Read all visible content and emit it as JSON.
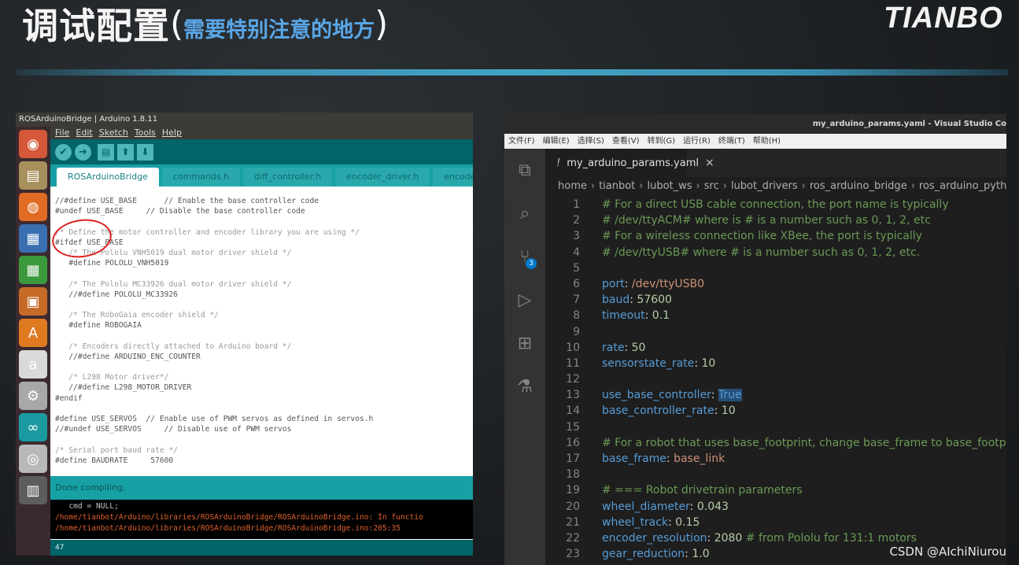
{
  "slide": {
    "title_main": "调试配置",
    "paren_open": "(",
    "title_sub": "需要特别注意的地方",
    "paren_close": ")",
    "logo": "TIANBO",
    "watermark": "CSDN @AIchiNiurou",
    "colors": {
      "title_sub": "#5aa7e8",
      "divider": "#48b8dd"
    }
  },
  "arduino": {
    "window_title": "ROSArduinoBridge | Arduino 1.8.11",
    "menu": [
      "File",
      "Edit",
      "Sketch",
      "Tools",
      "Help"
    ],
    "toolbar": {
      "verify_icon": "check-icon",
      "upload_icon": "arrow-right-icon",
      "new_icon": "new-file-icon",
      "open_icon": "open-arrow-up-icon",
      "save_icon": "save-arrow-down-icon"
    },
    "tabs": [
      "ROSArduinoBridge",
      "commands.h",
      "diff_controller.h",
      "encoder_driver.h",
      "encoder_"
    ],
    "active_tab": "ROSArduinoBridge",
    "code_lines": [
      {
        "text": "//#define USE_BASE      // Enable the base controller code",
        "style": "kw"
      },
      {
        "text": "#undef USE_BASE     // Disable the base controller code",
        "style": "kw"
      },
      {
        "text": "",
        "style": ""
      },
      {
        "text": "/* Define the motor controller and encoder library you are using */",
        "style": "cmt"
      },
      {
        "text": "#ifdef USE_BASE",
        "style": "kw"
      },
      {
        "text": "   /* The Pololu VNH5019 dual motor driver shield */",
        "style": "cmt"
      },
      {
        "text": "   #define POLOLU_VNH5019",
        "style": "kw"
      },
      {
        "text": "",
        "style": ""
      },
      {
        "text": "   /* The Pololu MC33926 dual motor driver shield */",
        "style": "cmt"
      },
      {
        "text": "   //#define POLOLU_MC33926",
        "style": "kw"
      },
      {
        "text": "",
        "style": ""
      },
      {
        "text": "   /* The RoboGaia encoder shield */",
        "style": "cmt"
      },
      {
        "text": "   #define ROBOGAIA",
        "style": "kw"
      },
      {
        "text": "",
        "style": ""
      },
      {
        "text": "   /* Encoders directly attached to Arduino board */",
        "style": "cmt"
      },
      {
        "text": "   //#define ARDUINO_ENC_COUNTER",
        "style": "kw"
      },
      {
        "text": "",
        "style": ""
      },
      {
        "text": "   /* L298 Motor driver*/",
        "style": "cmt"
      },
      {
        "text": "   //#define L298_MOTOR_DRIVER",
        "style": "kw"
      },
      {
        "text": "#endif",
        "style": "kw"
      },
      {
        "text": "",
        "style": ""
      },
      {
        "text": "#define USE_SERVOS  // Enable use of PWM servos as defined in servos.h",
        "style": "kw"
      },
      {
        "text": "//#undef USE_SERVOS     // Disable use of PWM servos",
        "style": "kw"
      },
      {
        "text": "",
        "style": ""
      },
      {
        "text": "/* Serial port baud rate */",
        "style": "cmt"
      },
      {
        "text": "#define BAUDRATE     57600",
        "style": "kw"
      }
    ],
    "status": "Done compiling.",
    "console_lines": [
      {
        "text": "   cmd = NULL;",
        "style": "dim"
      },
      {
        "text": "/home/tianbot/Arduino/libraries/ROSArduinoBridge/ROSArduinoBridge.ino: In functio",
        "style": ""
      },
      {
        "text": "/home/tianbot/Arduino/libraries/ROSArduinoBridge/ROSArduinoBridge.ino:205:35",
        "style": ""
      }
    ],
    "footer": "47",
    "launcher_icons": [
      {
        "name": "ubuntu-icon",
        "glyph": "◉",
        "bg": "#d4583a"
      },
      {
        "name": "files-icon",
        "glyph": "▤",
        "bg": "#a8905c"
      },
      {
        "name": "firefox-icon",
        "glyph": "◍",
        "bg": "#e06b22"
      },
      {
        "name": "writer-icon",
        "glyph": "▦",
        "bg": "#3a6fb0"
      },
      {
        "name": "calc-icon",
        "glyph": "▦",
        "bg": "#3c9a3c"
      },
      {
        "name": "impress-icon",
        "glyph": "▣",
        "bg": "#c66a28"
      },
      {
        "name": "software-center-icon",
        "glyph": "A",
        "bg": "#e07a20"
      },
      {
        "name": "amazon-icon",
        "glyph": "a",
        "bg": "#d9d9d9"
      },
      {
        "name": "settings-icon",
        "glyph": "⚙",
        "bg": "#a8a8a8"
      },
      {
        "name": "arduino-icon",
        "glyph": "∞",
        "bg": "#1a9aa0"
      },
      {
        "name": "disc-icon",
        "glyph": "◎",
        "bg": "#b9b9b9"
      },
      {
        "name": "trash-icon",
        "glyph": "▥",
        "bg": "#5d5d5d"
      }
    ]
  },
  "vscode": {
    "window_title": "my_arduino_params.yaml - Visual Studio Co",
    "menu": [
      "文件(F)",
      "编辑(E)",
      "选择(S)",
      "查看(V)",
      "转到(G)",
      "运行(R)",
      "终端(T)",
      "帮助(H)"
    ],
    "tab": {
      "label": "my_arduino_params.yaml",
      "prefix": "!",
      "close": "×"
    },
    "breadcrumb": [
      "home",
      "tianbot",
      "lubot_ws",
      "src",
      "lubot_drivers",
      "ros_arduino_bridge",
      "ros_arduino_pyth"
    ],
    "breadcrumb_sep": "›",
    "activity_icons": [
      {
        "name": "explorer-icon",
        "glyph": "⧉"
      },
      {
        "name": "search-icon",
        "glyph": "⌕"
      },
      {
        "name": "source-control-icon",
        "glyph": "⑂",
        "badge": "3"
      },
      {
        "name": "run-debug-icon",
        "glyph": "▷"
      },
      {
        "name": "extensions-icon",
        "glyph": "⊞"
      },
      {
        "name": "testing-icon",
        "glyph": "⚗"
      }
    ],
    "lines": [
      {
        "num": "1",
        "parts": [
          {
            "t": "# For a direct USB cable connection, the port name is typically",
            "c": "c"
          }
        ]
      },
      {
        "num": "2",
        "parts": [
          {
            "t": "# /dev/ttyACM# where is # is a number such as 0, 1, 2, etc",
            "c": "c"
          }
        ]
      },
      {
        "num": "3",
        "parts": [
          {
            "t": "# For a wireless connection like XBee, the port is typically",
            "c": "c"
          }
        ]
      },
      {
        "num": "4",
        "parts": [
          {
            "t": "# /dev/ttyUSB# where # is a number such as 0, 1, 2, etc.",
            "c": "c"
          }
        ]
      },
      {
        "num": "5",
        "parts": []
      },
      {
        "num": "6",
        "parts": [
          {
            "t": "port",
            "c": "k"
          },
          {
            "t": ": ",
            "c": ""
          },
          {
            "t": "/dev/ttyUSB0",
            "c": "v"
          }
        ]
      },
      {
        "num": "7",
        "parts": [
          {
            "t": "baud",
            "c": "k"
          },
          {
            "t": ": ",
            "c": ""
          },
          {
            "t": "57600",
            "c": "n"
          }
        ]
      },
      {
        "num": "8",
        "parts": [
          {
            "t": "timeout",
            "c": "k"
          },
          {
            "t": ": ",
            "c": ""
          },
          {
            "t": "0.1",
            "c": "n"
          }
        ]
      },
      {
        "num": "9",
        "parts": []
      },
      {
        "num": "10",
        "parts": [
          {
            "t": "rate",
            "c": "k"
          },
          {
            "t": ": ",
            "c": ""
          },
          {
            "t": "50",
            "c": "n"
          }
        ]
      },
      {
        "num": "11",
        "parts": [
          {
            "t": "sensorstate_rate",
            "c": "k"
          },
          {
            "t": ": ",
            "c": ""
          },
          {
            "t": "10",
            "c": "n"
          }
        ]
      },
      {
        "num": "12",
        "parts": []
      },
      {
        "num": "13",
        "parts": [
          {
            "t": "use_base_controller",
            "c": "k"
          },
          {
            "t": ": ",
            "c": ""
          },
          {
            "t": "True",
            "c": "sel"
          }
        ]
      },
      {
        "num": "14",
        "parts": [
          {
            "t": "base_controller_rate",
            "c": "k"
          },
          {
            "t": ": ",
            "c": ""
          },
          {
            "t": "10",
            "c": "n"
          }
        ]
      },
      {
        "num": "15",
        "parts": []
      },
      {
        "num": "16",
        "parts": [
          {
            "t": "# For a robot that uses base_footprint, change base_frame to base_footprin",
            "c": "c"
          }
        ]
      },
      {
        "num": "17",
        "parts": [
          {
            "t": "base_frame",
            "c": "k"
          },
          {
            "t": ": ",
            "c": ""
          },
          {
            "t": "base_link",
            "c": "v"
          }
        ]
      },
      {
        "num": "18",
        "parts": []
      },
      {
        "num": "19",
        "parts": [
          {
            "t": "# === Robot drivetrain parameters",
            "c": "c"
          }
        ]
      },
      {
        "num": "20",
        "parts": [
          {
            "t": "wheel_diameter",
            "c": "k"
          },
          {
            "t": ": ",
            "c": ""
          },
          {
            "t": "0.043",
            "c": "n"
          }
        ]
      },
      {
        "num": "21",
        "parts": [
          {
            "t": "wheel_track",
            "c": "k"
          },
          {
            "t": ": ",
            "c": ""
          },
          {
            "t": "0.15",
            "c": "n"
          }
        ]
      },
      {
        "num": "22",
        "parts": [
          {
            "t": "encoder_resolution",
            "c": "k"
          },
          {
            "t": ": ",
            "c": ""
          },
          {
            "t": "2080",
            "c": "n"
          },
          {
            "t": " # from Pololu for 131:1 motors",
            "c": "c"
          }
        ]
      },
      {
        "num": "23",
        "parts": [
          {
            "t": "gear_reduction",
            "c": "k"
          },
          {
            "t": ": ",
            "c": ""
          },
          {
            "t": "1.0",
            "c": "n"
          }
        ]
      }
    ]
  }
}
